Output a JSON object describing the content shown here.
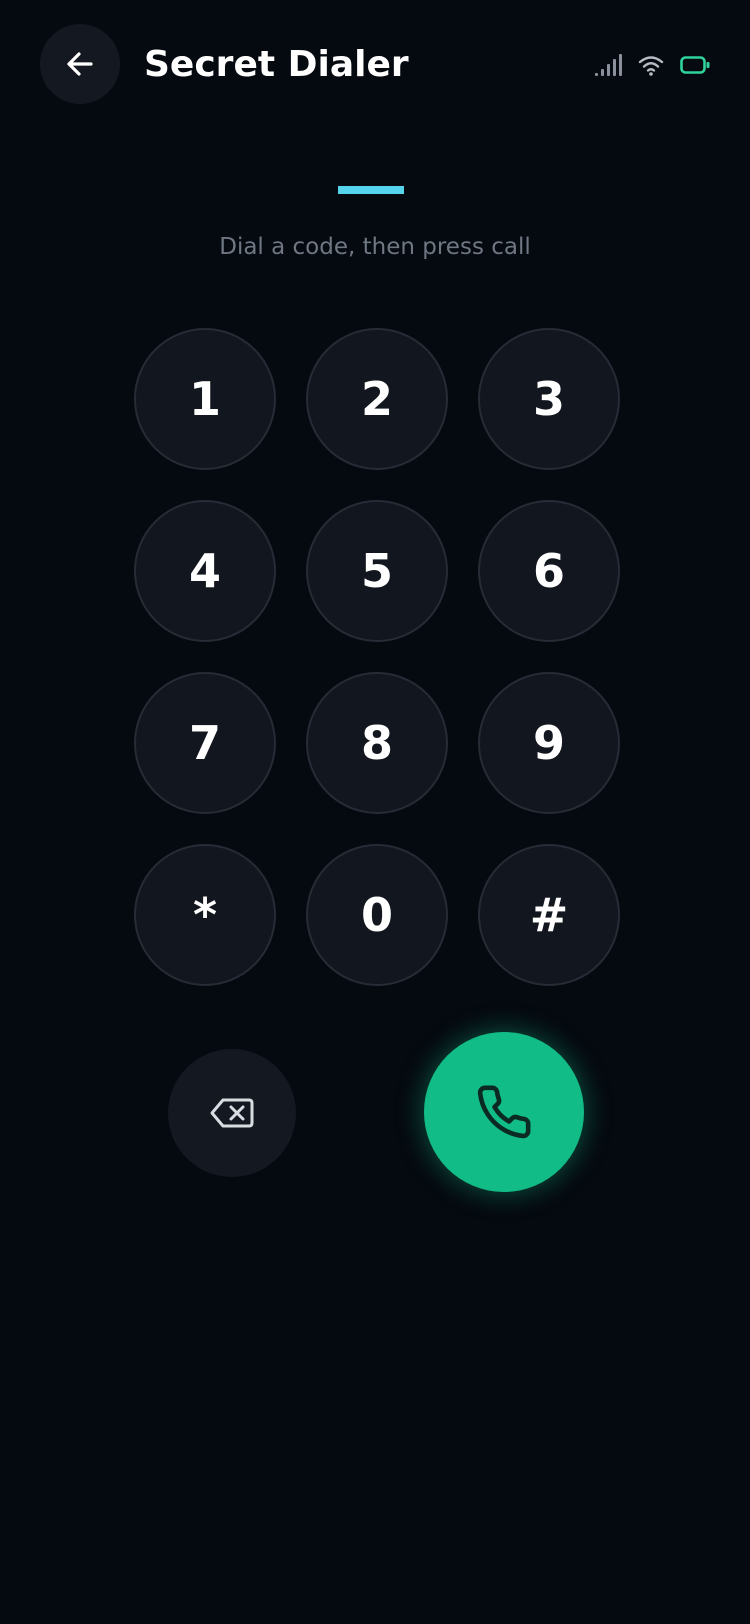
{
  "header": {
    "title": "Secret Dialer",
    "back_icon": "arrow-left-icon"
  },
  "status_bar": {
    "signal_icon": "signal-icon",
    "wifi_icon": "wifi-icon",
    "battery_icon": "battery-icon",
    "battery_color": "#2fd39b"
  },
  "display": {
    "code": "",
    "hint": "Dial a code, then press call",
    "cursor_color": "#56d4ee"
  },
  "keypad": {
    "keys": [
      "1",
      "2",
      "3",
      "4",
      "5",
      "6",
      "7",
      "8",
      "9",
      "*",
      "0",
      "#"
    ]
  },
  "actions": {
    "backspace_icon": "backspace-icon",
    "call_icon": "phone-icon",
    "call_color": "#12bc86"
  }
}
